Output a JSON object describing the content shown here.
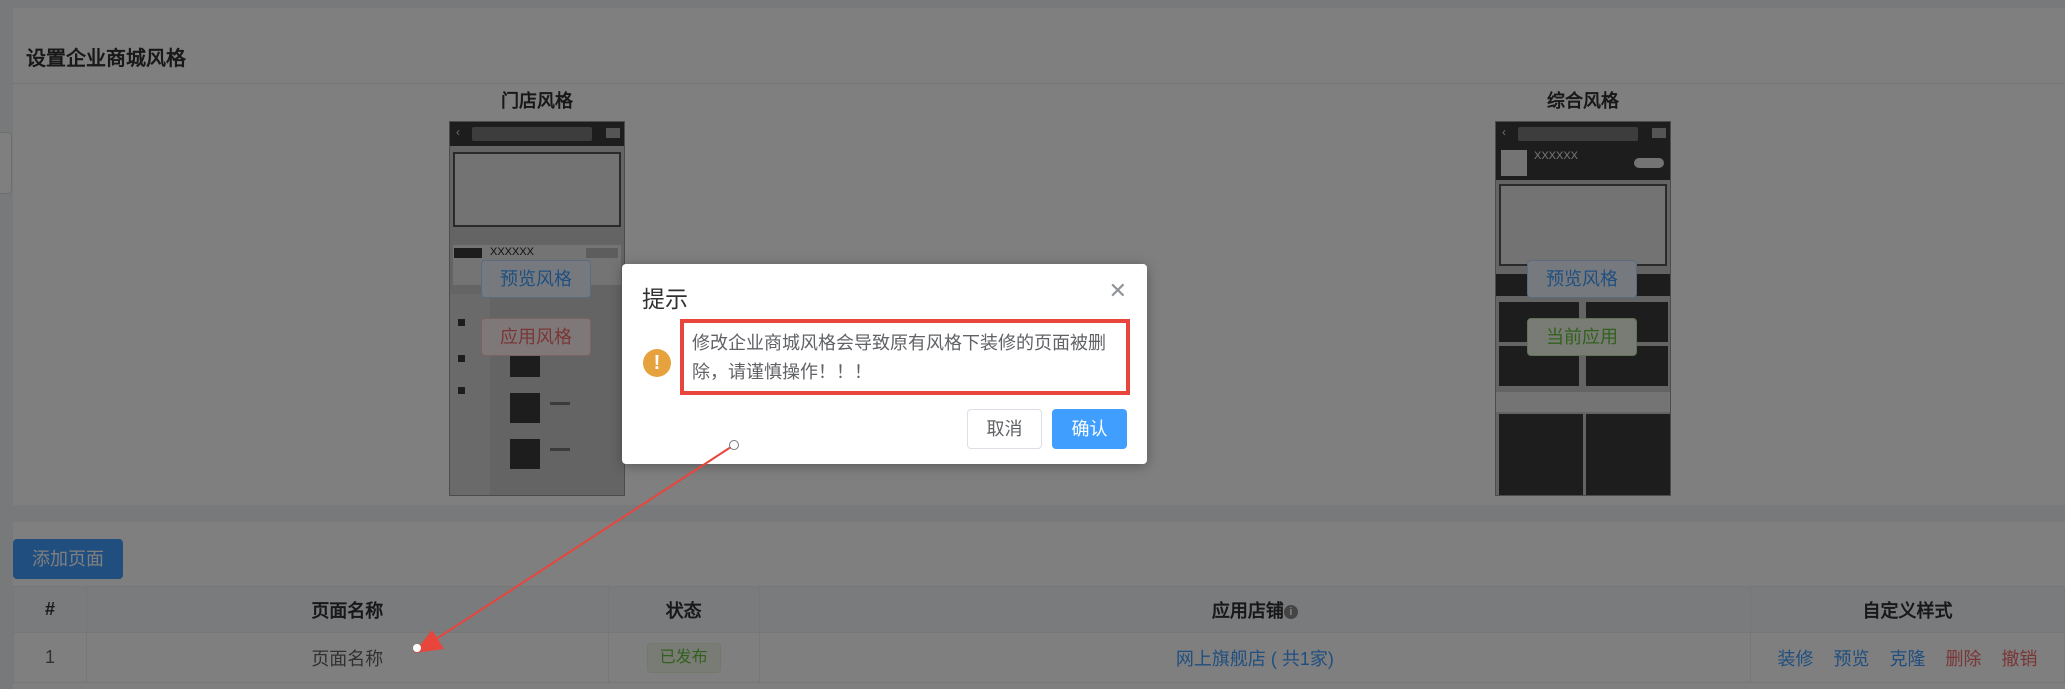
{
  "page": {
    "title": "设置企业商城风格"
  },
  "styles": {
    "store_style": {
      "title": "门店风格",
      "preview_label": "预览风格",
      "apply_label": "应用风格",
      "mock_text": "XXXXXX"
    },
    "general_style": {
      "title": "综合风格",
      "preview_label": "预览风格",
      "current_label": "当前应用",
      "mock_text": "XXXXXX"
    }
  },
  "toolbar": {
    "add_page_label": "添加页面"
  },
  "table": {
    "headers": [
      "#",
      "页面名称",
      "状态",
      "应用店铺",
      "自定义样式"
    ],
    "rows": [
      {
        "index": "1",
        "name": "页面名称",
        "status": "已发布",
        "shop": "网上旗舰店 ( 共1家)",
        "actions": [
          "装修",
          "预览",
          "克隆",
          "删除",
          "撤销"
        ]
      }
    ]
  },
  "dialog": {
    "title": "提示",
    "message": "修改企业商城风格会导致原有风格下装修的页面被删除，请谨慎操作！！！",
    "cancel_label": "取消",
    "confirm_label": "确认"
  },
  "colors": {
    "primary": "#409eff",
    "danger": "#f56c6c",
    "success": "#67c23a",
    "warning": "#e6a23c",
    "annotation": "#e8453c"
  },
  "icons": {
    "warning": "exclamation-circle",
    "close": "x",
    "info": "info-circle"
  }
}
